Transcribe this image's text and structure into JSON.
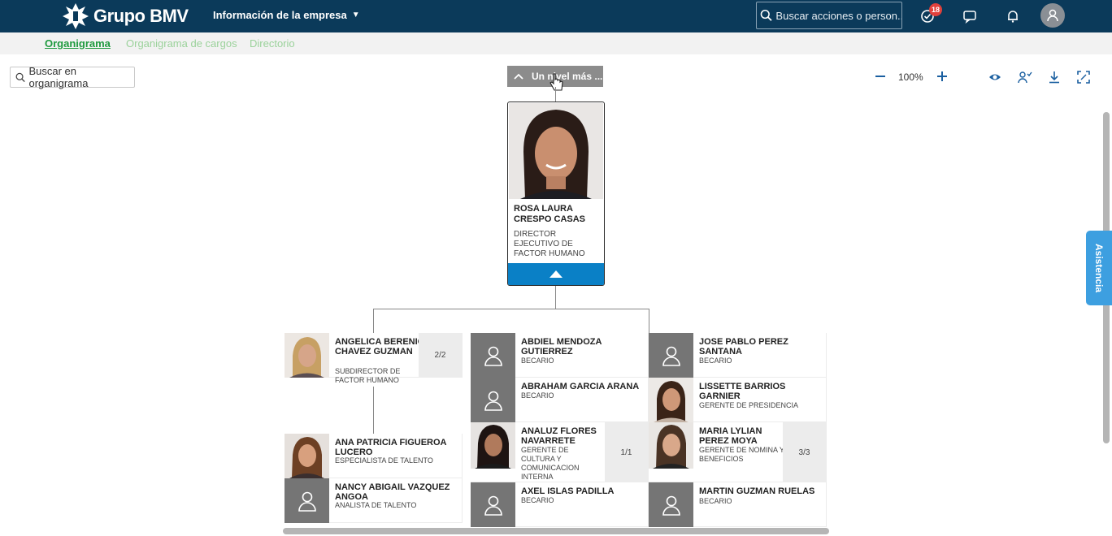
{
  "header": {
    "brand": "Grupo BMV",
    "module": "Información de la empresa",
    "search_placeholder": "Buscar acciones o person...",
    "notifications_count": "18",
    "icons": [
      "logo-icon",
      "search-icon",
      "todo-check-icon",
      "feedback-icon",
      "bell-icon",
      "user-avatar-icon"
    ]
  },
  "tabs": [
    "Organigrama",
    "Organigrama de cargos",
    "Directorio"
  ],
  "toolbar": {
    "org_search_placeholder": "Buscar en organigrama",
    "level_up_label": "Un nivel más ...",
    "zoom": "100%",
    "icons": [
      "zoom-out-icon",
      "zoom-in-icon",
      "eye-icon",
      "user-check-icon",
      "download-icon",
      "fullscreen-icon"
    ]
  },
  "root": {
    "name": "ROSA LAURA CRESPO CASAS",
    "title": "DIRECTOR EJECUTIVO DE FACTOR HUMANO"
  },
  "column1": [
    {
      "name": "ANGELICA BERENICE CHAVEZ GUZMAN",
      "title": "SUBDIRECTOR DE FACTOR HUMANO",
      "count": "2/2",
      "photo": true
    }
  ],
  "column1_children": [
    {
      "name": "ANA PATRICIA FIGUEROA LUCERO",
      "title": "ESPECIALISTA DE TALENTO",
      "photo": true
    },
    {
      "name": "NANCY ABIGAIL VAZQUEZ ANGOA",
      "title": "ANALISTA DE TALENTO",
      "photo": false
    }
  ],
  "column2": [
    {
      "name": "ABDIEL MENDOZA GUTIERREZ",
      "title": "BECARIO",
      "photo": false
    },
    {
      "name": "ABRAHAM GARCIA ARANA",
      "title": "BECARIO",
      "photo": false
    },
    {
      "name": "ANALUZ   FLORES NAVARRETE",
      "title": "GERENTE DE CULTURA Y COMUNICACION INTERNA",
      "count": "1/1",
      "photo": true
    },
    {
      "name": "AXEL ISLAS PADILLA",
      "title": "BECARIO",
      "photo": false
    }
  ],
  "column3": [
    {
      "name": "JOSE PABLO PEREZ SANTANA",
      "title": "BECARIO",
      "photo": false
    },
    {
      "name": "LISSETTE   BARRIOS GARNIER",
      "title": "GERENTE DE PRESIDENCIA",
      "photo": true
    },
    {
      "name": "MARIA LYLIAN PEREZ MOYA",
      "title": "GERENTE DE NOMINA Y BENEFICIOS",
      "count": "3/3",
      "photo": true
    },
    {
      "name": "MARTIN GUZMAN RUELAS",
      "title": "BECARIO",
      "photo": false
    }
  ],
  "side_tab": "Asistencia",
  "colors": {
    "header_bg": "#0b3a5a",
    "accent_blue": "#0a80c6",
    "tab_active": "#1f9a3f",
    "badge": "#e0413c"
  }
}
